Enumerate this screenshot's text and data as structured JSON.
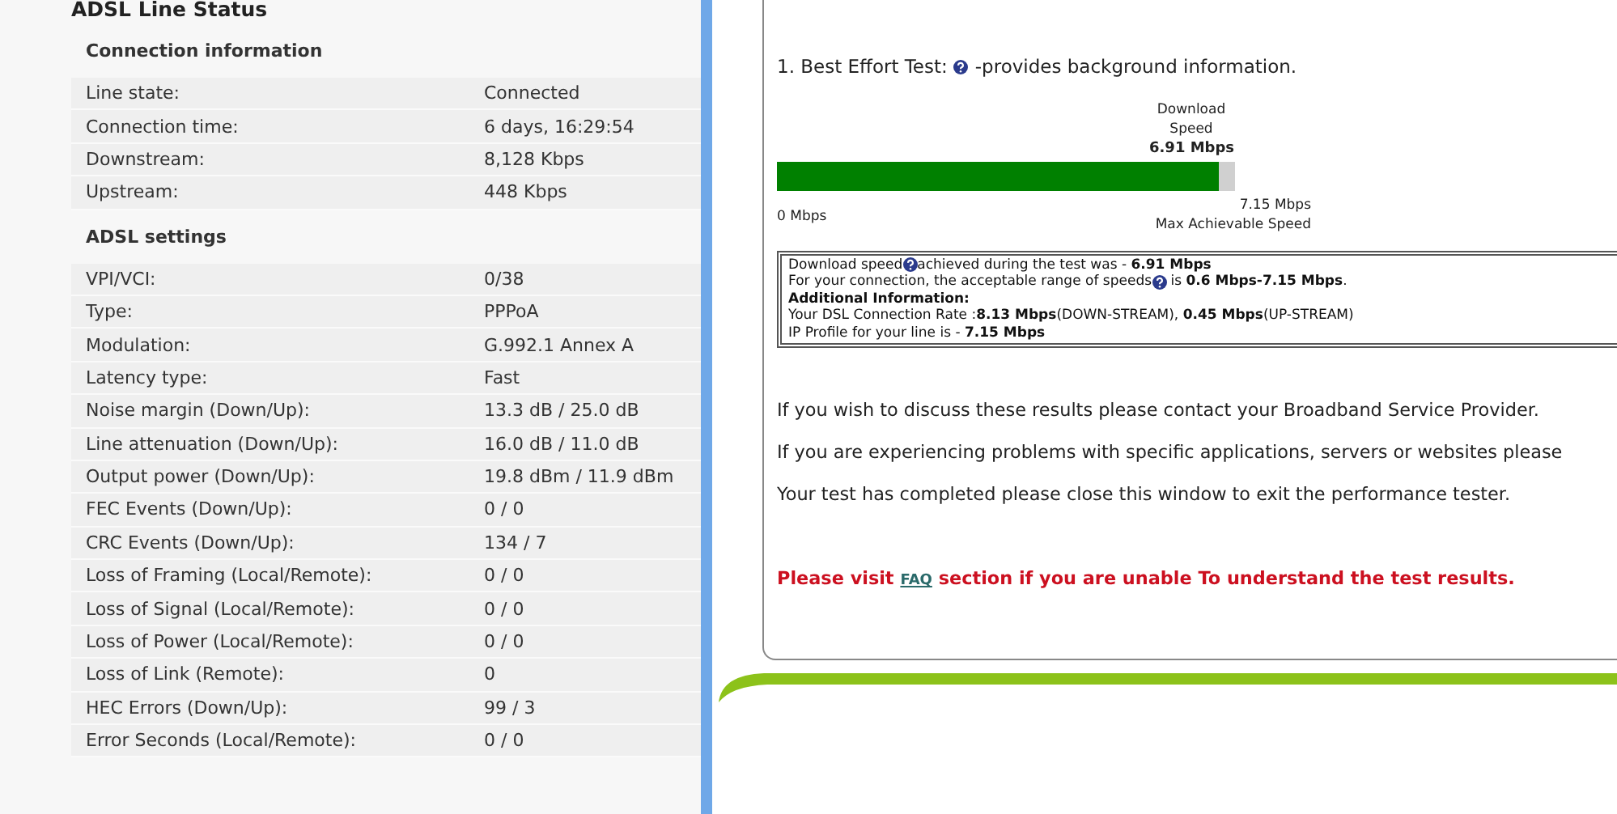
{
  "status_panel": {
    "title": "ADSL Line Status",
    "sections": [
      {
        "heading": "Connection information",
        "rows": [
          {
            "label": "Line state:",
            "value": "Connected"
          },
          {
            "label": "Connection time:",
            "value": "6 days, 16:29:54"
          },
          {
            "label": "Downstream:",
            "value": "8,128 Kbps"
          },
          {
            "label": "Upstream:",
            "value": "448 Kbps"
          }
        ]
      },
      {
        "heading": "ADSL settings",
        "rows": [
          {
            "label": "VPI/VCI:",
            "value": "0/38"
          },
          {
            "label": "Type:",
            "value": "PPPoA"
          },
          {
            "label": "Modulation:",
            "value": "G.992.1 Annex A"
          },
          {
            "label": "Latency type:",
            "value": "Fast"
          },
          {
            "label": "Noise margin (Down/Up):",
            "value": "13.3 dB / 25.0 dB"
          },
          {
            "label": "Line attenuation (Down/Up):",
            "value": "16.0 dB / 11.0 dB"
          },
          {
            "label": "Output power (Down/Up):",
            "value": "19.8 dBm / 11.9 dBm"
          },
          {
            "label": "FEC Events (Down/Up):",
            "value": "0 / 0"
          },
          {
            "label": "CRC Events (Down/Up):",
            "value": "134 / 7"
          },
          {
            "label": "Loss of Framing (Local/Remote):",
            "value": "0 / 0"
          },
          {
            "label": "Loss of Signal (Local/Remote):",
            "value": "0 / 0"
          },
          {
            "label": "Loss of Power (Local/Remote):",
            "value": "0 / 0"
          },
          {
            "label": "Loss of Link (Remote):",
            "value": "0"
          },
          {
            "label": "HEC Errors (Down/Up):",
            "value": "99 / 3"
          },
          {
            "label": "Error Seconds (Local/Remote):",
            "value": "0 / 0"
          }
        ]
      }
    ]
  },
  "speed_test": {
    "test_title": "1. Best Effort Test:",
    "test_note": "-provides background information.",
    "meter": {
      "caption": "Download Speed",
      "reading": "6.91 Mbps",
      "level": 0.966,
      "min_label": "0 Mbps",
      "max_label": "7.15 Mbps",
      "max_caption": "Max Achievable Speed"
    },
    "info_lines": [
      {
        "kind": "help",
        "text": "Download speed",
        "rest": "achieved during the test was - **6.91 Mbps**"
      },
      {
        "kind": "help",
        "text": "For your connection, the acceptable range of speeds",
        "rest": " is **0.6 Mbps-7.15 Mbps**."
      },
      {
        "kind": "heading",
        "text": "Additional Information:"
      },
      {
        "kind": "plain",
        "text": "Your DSL Connection Rate :**8.13 Mbps**(DOWN-STREAM), **0.45 Mbps**(UP-STREAM)"
      },
      {
        "kind": "plain",
        "text": "IP Profile for your line is - **7.15 Mbps**"
      }
    ],
    "paragraphs": [
      "If you wish to discuss these results please contact your Broadband Service Provider.",
      "If you are experiencing problems with specific applications, servers or websites please",
      "Your test has completed please close this window to exit the performance tester."
    ],
    "notice": {
      "before": "Please visit",
      "link": "FAQ",
      "after": "section if you are unable To understand the test results."
    }
  }
}
